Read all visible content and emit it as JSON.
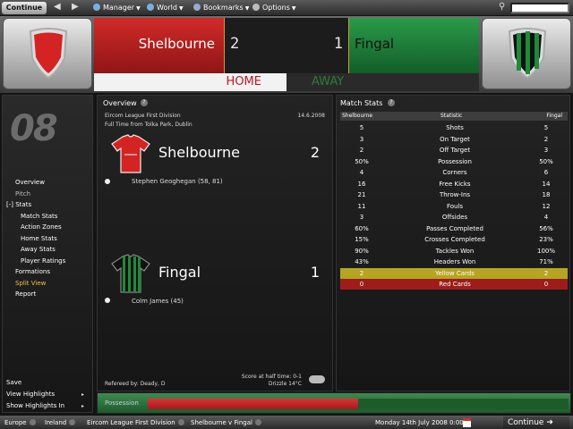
{
  "topbar": {
    "continue_label": "Continue",
    "menu": [
      {
        "label": "Manager",
        "icon": "manager-icon"
      },
      {
        "label": "World",
        "icon": "globe-icon"
      },
      {
        "label": "Bookmarks",
        "icon": "bookmark-icon"
      },
      {
        "label": "Options",
        "icon": "gear-icon"
      }
    ],
    "search_placeholder": ""
  },
  "match": {
    "home": {
      "name": "Shelbourne",
      "score": "2",
      "color": "#c0171f"
    },
    "away": {
      "name": "Fingal",
      "score": "1",
      "color": "#1f7a3a"
    },
    "tabs": {
      "home": "HOME",
      "away": "AWAY"
    }
  },
  "sidebar": {
    "logo": "08",
    "items": [
      {
        "label": "Overview"
      },
      {
        "label": "Pitch"
      },
      {
        "label": "Stats",
        "expander": "[-]"
      },
      {
        "label": "Match Stats"
      },
      {
        "label": "Action Zones"
      },
      {
        "label": "Home Stats"
      },
      {
        "label": "Away Stats"
      },
      {
        "label": "Player Ratings"
      },
      {
        "label": "Formations"
      },
      {
        "label": "Split View"
      },
      {
        "label": "Report"
      }
    ],
    "bottom": [
      {
        "label": "Save"
      },
      {
        "label": "View Highlights"
      },
      {
        "label": "Show Highlights In"
      }
    ]
  },
  "overview": {
    "title": "Overview",
    "competition": "Eircom League First Division",
    "date": "14.6.2008",
    "venue": "Full Time from Tolka Park, Dublin",
    "home_team": "Shelbourne",
    "home_goals": "2",
    "home_scorers": "Stephen Geoghegan (58, 81)",
    "away_team": "Fingal",
    "away_goals": "1",
    "away_scorers": "Colm James (45)",
    "referee": "Refereed by: Deady, D",
    "half_time": "Score at half time: 0-1",
    "weather": "Drizzle 14°C"
  },
  "stats": {
    "title": "Match Stats",
    "headers": {
      "home": "Shelbourne",
      "stat": "Statistic",
      "away": "Fingal"
    },
    "rows": [
      {
        "home": "5",
        "stat": "Shots",
        "away": "5"
      },
      {
        "home": "3",
        "stat": "On Target",
        "away": "2"
      },
      {
        "home": "2",
        "stat": "Off Target",
        "away": "3"
      },
      {
        "home": "50%",
        "stat": "Possession",
        "away": "50%"
      },
      {
        "home": "4",
        "stat": "Corners",
        "away": "6"
      },
      {
        "home": "16",
        "stat": "Free Kicks",
        "away": "14"
      },
      {
        "home": "21",
        "stat": "Throw-Ins",
        "away": "18"
      },
      {
        "home": "11",
        "stat": "Fouls",
        "away": "12"
      },
      {
        "home": "3",
        "stat": "Offsides",
        "away": "4"
      },
      {
        "home": "60%",
        "stat": "Passes Completed",
        "away": "56%"
      },
      {
        "home": "15%",
        "stat": "Crosses Completed",
        "away": "23%"
      },
      {
        "home": "90%",
        "stat": "Tackles Won",
        "away": "100%"
      },
      {
        "home": "43%",
        "stat": "Headers Won",
        "away": "71%"
      },
      {
        "home": "2",
        "stat": "Yellow Cards",
        "away": "2",
        "highlight": "yellow"
      },
      {
        "home": "0",
        "stat": "Red Cards",
        "away": "0",
        "highlight": "red"
      }
    ]
  },
  "possession": {
    "label": "Possession",
    "home_fraction": 0.5
  },
  "bottombar": {
    "crumbs": [
      "Europe",
      "Ireland",
      "Eircom League First Division",
      "Shelbourne v Fingal"
    ],
    "date": "Monday 14th July 2008 0:00",
    "continue_label": "Continue"
  }
}
